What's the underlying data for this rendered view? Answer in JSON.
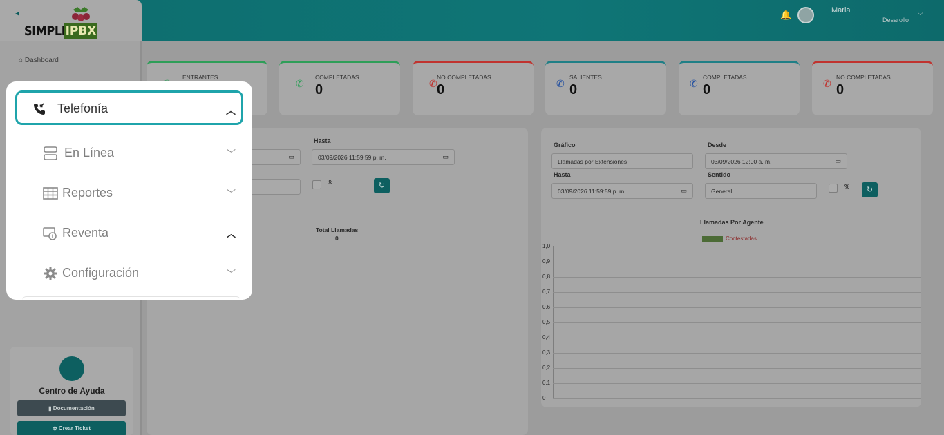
{
  "brand": {
    "simple": "SIMPLE",
    "ipbx": "IPBX"
  },
  "user": {
    "name": "Maria",
    "role": "Desarollo"
  },
  "sidebar": {
    "dashboard": "Dashboard"
  },
  "menu": {
    "telefonia": "Telefonía",
    "items": [
      {
        "label": "En Línea",
        "expanded": false
      },
      {
        "label": "Reportes",
        "expanded": false
      },
      {
        "label": "Reventa",
        "expanded": true
      },
      {
        "label": "Configuración",
        "expanded": false
      }
    ]
  },
  "help": {
    "title": "Centro de Ayuda",
    "docs": "Documentación",
    "ticket": "Crear Ticket"
  },
  "stats": [
    {
      "label": "ENTRANTES",
      "value": "",
      "color": "#2e9e58"
    },
    {
      "label": "COMPLETADAS",
      "value": "0",
      "color": "#2e9e58"
    },
    {
      "label": "NO COMPLETADAS",
      "value": "0",
      "color": "#c0332f"
    },
    {
      "label": "SALIENTES",
      "value": "0",
      "color": "#1f7f86"
    },
    {
      "label": "COMPLETADAS",
      "value": "0",
      "color": "#1f7f86"
    },
    {
      "label": "NO COMPLETADAS",
      "value": "0",
      "color": "#c0332f"
    }
  ],
  "left_panel": {
    "hasta_label": "Hasta",
    "hasta_value": "03/09/2026 11:59:59 p. m.",
    "percent": "%",
    "total_label": "Total Llamadas",
    "total_value": "0"
  },
  "right_panel": {
    "grafico_label": "Gráfico",
    "grafico_value": "Llamadas por Extensiones",
    "desde_label": "Desde",
    "desde_value": "03/09/2026 12:00 a. m.",
    "hasta_label": "Hasta",
    "hasta_value": "03/09/2026 11:59:59 p. m.",
    "sentido_label": "Sentido",
    "sentido_value": "General",
    "percent": "%"
  },
  "chart_data": {
    "type": "bar",
    "title": "Llamadas Por Agente",
    "categories": [],
    "series": [
      {
        "name": "Contestadas",
        "values": []
      }
    ],
    "ylim": [
      0,
      1.0
    ],
    "yticks": [
      "1,0",
      "0,9",
      "0,8",
      "0,7",
      "0,6",
      "0,5",
      "0,4",
      "0,3",
      "0,2",
      "0,1",
      "0"
    ],
    "grid": true,
    "legend": "top"
  }
}
